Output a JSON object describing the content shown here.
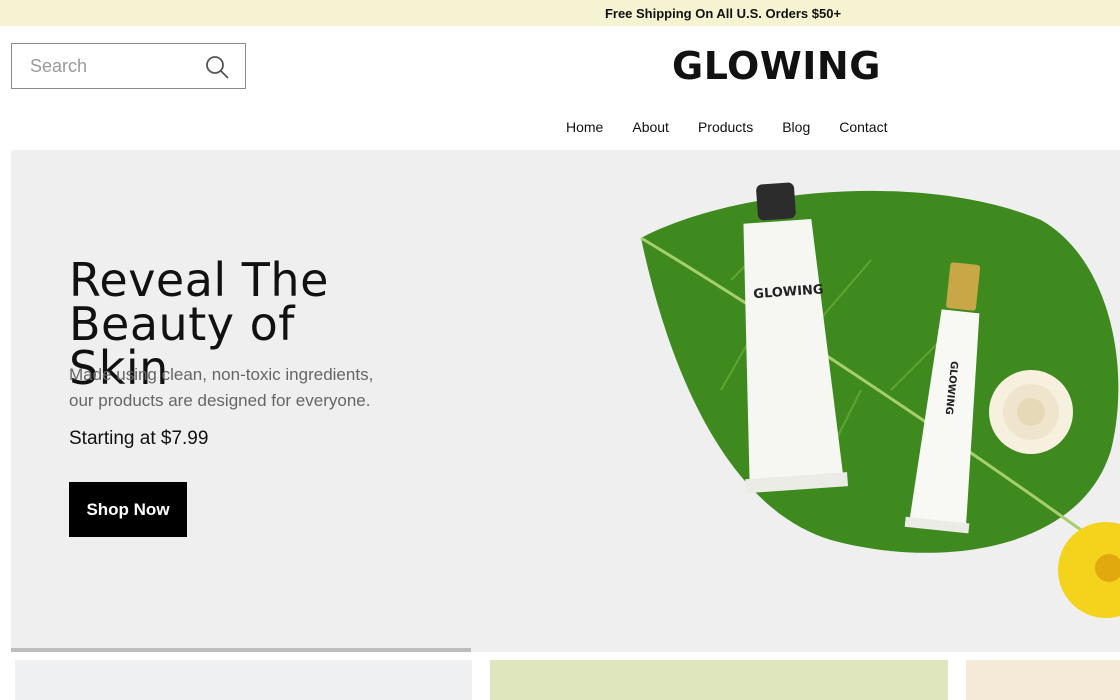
{
  "announcement": "Free Shipping On All U.S. Orders $50+",
  "search": {
    "placeholder": "Search"
  },
  "brand": {
    "name": "GLOWING"
  },
  "nav": {
    "items": [
      {
        "label": "Home"
      },
      {
        "label": "About"
      },
      {
        "label": "Products"
      },
      {
        "label": "Blog"
      },
      {
        "label": "Contact"
      }
    ]
  },
  "hero": {
    "title_line1": "Reveal The",
    "title_line2": "Beauty of Skin",
    "subtitle_line1": "Made using clean, non-toxic ingredients,",
    "subtitle_line2": "our products are designed for everyone.",
    "price": "Starting at $7.99",
    "cta": "Shop Now",
    "product_brand": "GLOWING",
    "carousel_progress": 0.42
  },
  "colors": {
    "announcement_bg": "#f6f3d3",
    "hero_bg": "#efeff0",
    "button_bg": "#000000",
    "leaf": "#3f8a1f",
    "card2_bg": "#dfe5bd",
    "card3_bg": "#f4ead7"
  },
  "icons": {
    "search": "search-icon"
  }
}
